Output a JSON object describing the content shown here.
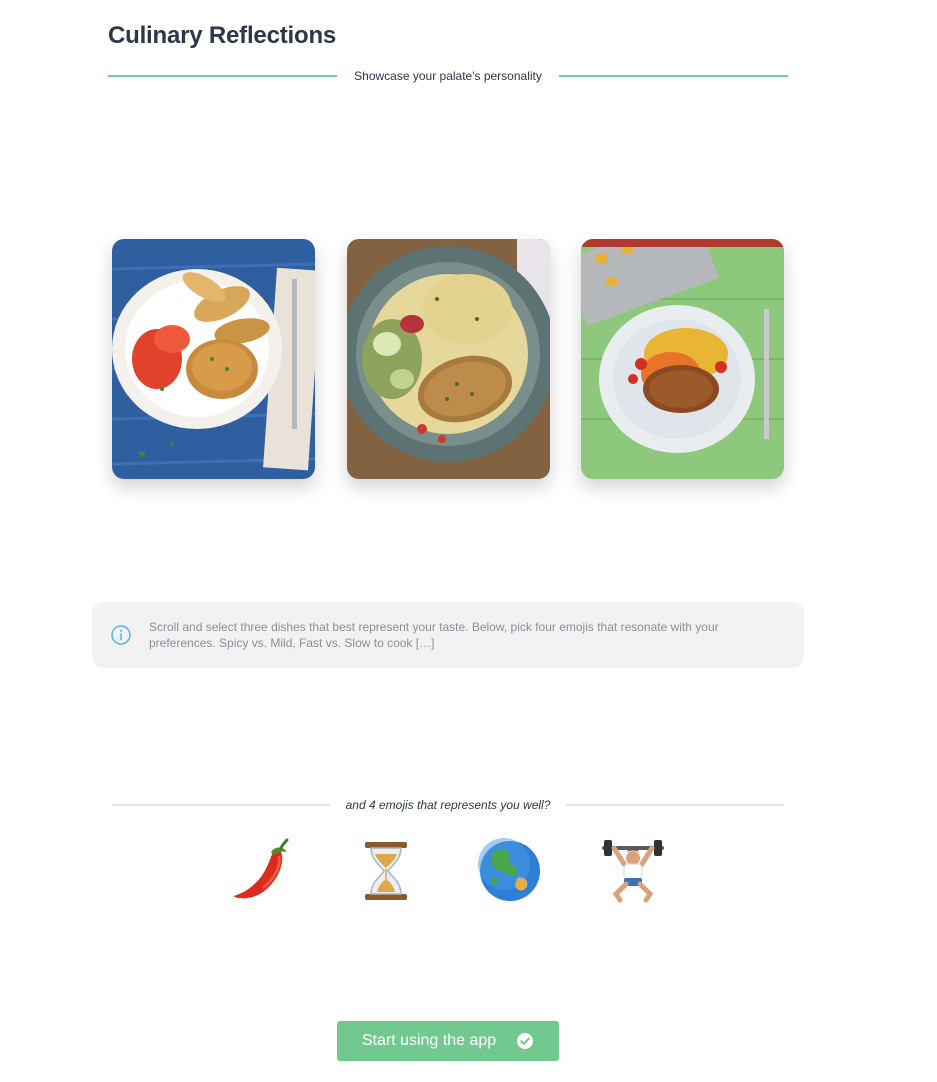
{
  "header": {
    "title": "Culinary Reflections",
    "subtitle": "Showcase your palate's personality"
  },
  "dishes": [
    {
      "icon": "chicken-potato-wedges-tomato-plate"
    },
    {
      "icon": "chicken-orzo-zucchini-bowl"
    },
    {
      "icon": "roasted-chicken-vegetables-plate"
    }
  ],
  "info": {
    "icon": "info-icon",
    "text": "Scroll and select three dishes that best represent your taste. Below, pick four emojis that resonate with your preferences. Spicy vs. Mild, Fast vs. Slow to cook […]"
  },
  "emoji_section": {
    "caption": "and 4 emojis that represents you well?",
    "emojis": [
      {
        "icon": "hot-pepper-icon"
      },
      {
        "icon": "hourglass-icon"
      },
      {
        "icon": "globe-icon"
      },
      {
        "icon": "weightlifter-icon"
      }
    ]
  },
  "cta": {
    "label": "Start using the app",
    "icon": "check-circle-icon"
  },
  "colors": {
    "accent_green": "#72c98f",
    "divider_green": "#68c690",
    "title_text": "#2d3748",
    "info_bg": "#f2f2f2",
    "info_icon": "#63b3ed"
  }
}
